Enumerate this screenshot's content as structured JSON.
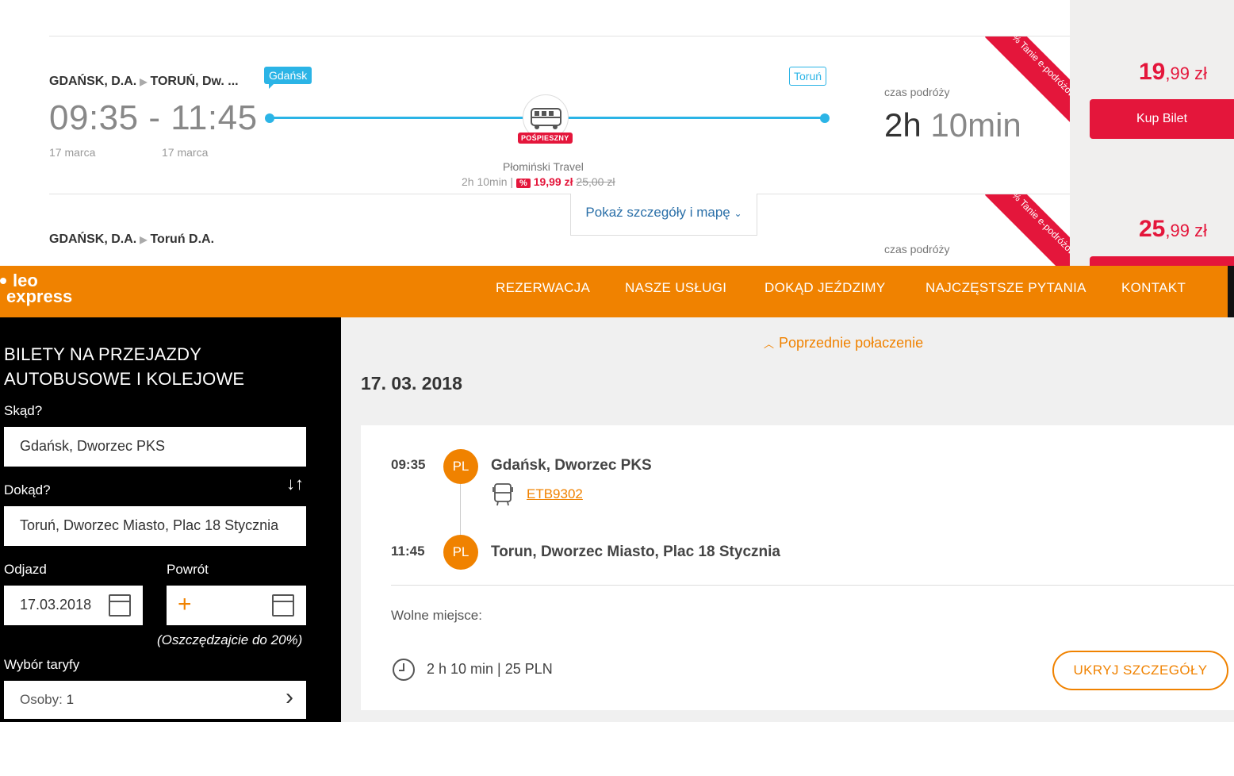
{
  "results": {
    "rows": [
      {
        "from": "GDAŃSK, D.A.",
        "to": "TORUŃ, Dw. ...",
        "departure": "09:35",
        "arrival": "11:45",
        "times": "09:35 - 11:45",
        "dep_date": "17 marca",
        "arr_date": "17 marca",
        "bubble_from": "Gdańsk",
        "bubble_to": "Toruń",
        "badge": "POŚPIESZNY",
        "operator": "Płomiński Travel",
        "summary_duration": "2h 10min |",
        "summary_pct": "%",
        "summary_price": "19,99 zł",
        "summary_old_price": "25,00 zł",
        "czas_label": "czas podróży",
        "duration_h": "2h",
        "duration_m": "10min",
        "ribbon": "Tanie e-podróżowanie",
        "ribbon_pct": "%",
        "price_int": "19",
        "price_dec": ",99 zł",
        "buy_label": "Kup Bilet"
      },
      {
        "from": "GDAŃSK, D.A.",
        "to": "Toruń D.A.",
        "czas_label": "czas podróży",
        "ribbon": "Tanie e-podróżowanie",
        "ribbon_pct": "%",
        "price_int": "25",
        "price_dec": ",99 zł"
      }
    ],
    "details_link": "Pokaż szczegóły i mapę"
  },
  "leo": {
    "logo_line1": "leo",
    "logo_line2": "express",
    "nav": [
      "REZERWACJA",
      "NASZE USŁUGI",
      "DOKĄD JEŹDZIMY",
      "NAJCZĘSTSZE PYTANIA",
      "KONTAKT"
    ],
    "brand_color": "#f08200"
  },
  "search": {
    "title_line1": "BILETY NA PRZEJAZDY",
    "title_line2": "AUTOBUSOWE I KOLEJOWE",
    "from_label": "Skąd?",
    "from_value": "Gdańsk, Dworzec PKS",
    "to_label": "Dokąd?",
    "to_value": "Toruń, Dworzec Miasto, Plac 18 Stycznia",
    "depart_label": "Odjazd",
    "depart_value": "17.03.2018",
    "return_label": "Powrót",
    "return_plus": "+",
    "return_note": "(Oszczędzajcie do 20%)",
    "tariff_label": "Wybór taryfy",
    "persons_label": "Osoby:",
    "persons_value": "1",
    "swap_icon": "↓↑",
    "chevron": "›"
  },
  "detail": {
    "prev_link": "Poprzednie połaczenie",
    "date": "17. 03. 2018",
    "dep_time": "09:35",
    "dep_country": "PL",
    "dep_station": "Gdańsk, Dworzec PKS",
    "train_code": "ETB9302",
    "arr_time": "11:45",
    "arr_country": "PL",
    "arr_station": "Torun, Dworzec Miasto, Plac 18 Stycznia",
    "free_seats": "Wolne miejsce:",
    "trip_info": "2 h 10 min | 25 PLN",
    "hide_button": "UKRYJ SZCZEGÓŁY"
  }
}
